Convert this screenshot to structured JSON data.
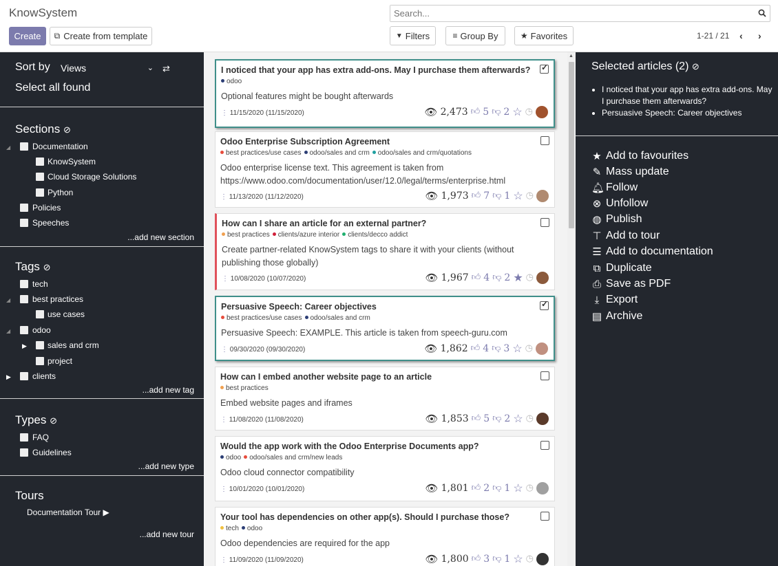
{
  "app": {
    "title": "KnowSystem"
  },
  "toolbar": {
    "create_label": "Create",
    "template_label": "Create from template"
  },
  "search": {
    "placeholder": "Search..."
  },
  "filters": {
    "filters_label": "Filters",
    "groupby_label": "Group By",
    "favorites_label": "Favorites"
  },
  "pager": {
    "range": "1-21 / 21"
  },
  "sidebar": {
    "sort_label": "Sort by",
    "sort_value": "Views",
    "select_all": "Select all found",
    "sections_title": "Sections",
    "sections": [
      "Documentation",
      "KnowSystem",
      "Cloud Storage Solutions",
      "Python",
      "Policies",
      "Speeches"
    ],
    "add_section": "...add new section",
    "tags_title": "Tags",
    "tags": [
      "tech",
      "best practices",
      "use cases",
      "odoo",
      "sales and crm",
      "project",
      "clients"
    ],
    "add_tag": "...add new tag",
    "types_title": "Types",
    "types": [
      "FAQ",
      "Guidelines"
    ],
    "add_type": "...add new type",
    "tours_title": "Tours",
    "tours": [
      "Documentation Tour"
    ],
    "add_tour": "...add new tour"
  },
  "articles": [
    {
      "title": "I noticed that your app has extra add-ons. May I purchase them afterwards?",
      "tags": [
        {
          "name": "odoo",
          "color": "#2c3e75"
        }
      ],
      "desc": "Optional features might be bought afterwards",
      "date": "11/15/2020 (11/15/2020)",
      "views": "2,473",
      "likes": "5",
      "dislikes": "2",
      "selected": true
    },
    {
      "title": "Odoo Enterprise Subscription Agreement",
      "tags": [
        {
          "name": "best practices/use cases",
          "color": "#e74c3c"
        },
        {
          "name": "odoo/sales and crm",
          "color": "#2c3e75"
        },
        {
          "name": "odoo/sales and crm/quotations",
          "color": "#20a0a0"
        }
      ],
      "desc": "Odoo enterprise license text. This agreement is taken from https://www.odoo.com/documentation/user/12.0/legal/terms/enterprise.html",
      "date": "11/13/2020 (11/12/2020)",
      "views": "1,973",
      "likes": "7",
      "dislikes": "1",
      "selected": false
    },
    {
      "title": "How can I share an article for an external partner?",
      "tags": [
        {
          "name": "best practices",
          "color": "#f0a050"
        },
        {
          "name": "clients/azure interior",
          "color": "#d0203a"
        },
        {
          "name": "clients/decco addict",
          "color": "#20b070"
        }
      ],
      "desc": "Create partner-related KnowSystem tags to share it with your clients (without publishing those globally)",
      "date": "10/08/2020 (10/07/2020)",
      "views": "1,967",
      "likes": "4",
      "dislikes": "2",
      "selected": false
    },
    {
      "title": "Persuasive Speech: Career objectives",
      "tags": [
        {
          "name": "best practices/use cases",
          "color": "#e74c3c"
        },
        {
          "name": "odoo/sales and crm",
          "color": "#2c3e75"
        }
      ],
      "desc": "Persuasive Speech: EXAMPLE. This article is taken from speech-guru.com",
      "date": "09/30/2020 (09/30/2020)",
      "views": "1,862",
      "likes": "4",
      "dislikes": "3",
      "selected": true
    },
    {
      "title": "How can I embed another website page to an article",
      "tags": [
        {
          "name": "best practices",
          "color": "#f0a050"
        }
      ],
      "desc": "Embed website pages and iframes",
      "date": "11/08/2020 (11/08/2020)",
      "views": "1,853",
      "likes": "5",
      "dislikes": "2",
      "selected": false
    },
    {
      "title": "Would the app work with the Odoo Enterprise Documents app?",
      "tags": [
        {
          "name": "odoo",
          "color": "#2c3e75"
        },
        {
          "name": "odoo/sales and crm/new leads",
          "color": "#e74c3c"
        }
      ],
      "desc": "Odoo cloud connector compatibility",
      "date": "10/01/2020 (10/01/2020)",
      "views": "1,801",
      "likes": "2",
      "dislikes": "1",
      "selected": false
    },
    {
      "title": "Your tool has dependencies on other app(s). Should I purchase those?",
      "tags": [
        {
          "name": "tech",
          "color": "#f0c040"
        },
        {
          "name": "odoo",
          "color": "#2c3e75"
        }
      ],
      "desc": "Odoo dependencies are required for the app",
      "date": "11/09/2020 (11/09/2020)",
      "views": "1,800",
      "likes": "3",
      "dislikes": "1",
      "selected": false
    }
  ],
  "selection": {
    "title": "Selected articles (2)",
    "items": [
      "I noticed that your app has extra add-ons. May I purchase them afterwards?",
      "Persuasive Speech: Career objectives"
    ]
  },
  "actions": [
    "Add to favourites",
    "Mass update",
    "Follow",
    "Unfollow",
    "Publish",
    "Add to tour",
    "Add to documentation",
    "Duplicate",
    "Save as PDF",
    "Export",
    "Archive"
  ],
  "colors": {
    "accent": "#7c7bad",
    "selected_border": "#3f8f8a",
    "panel_bg": "#23272e"
  }
}
